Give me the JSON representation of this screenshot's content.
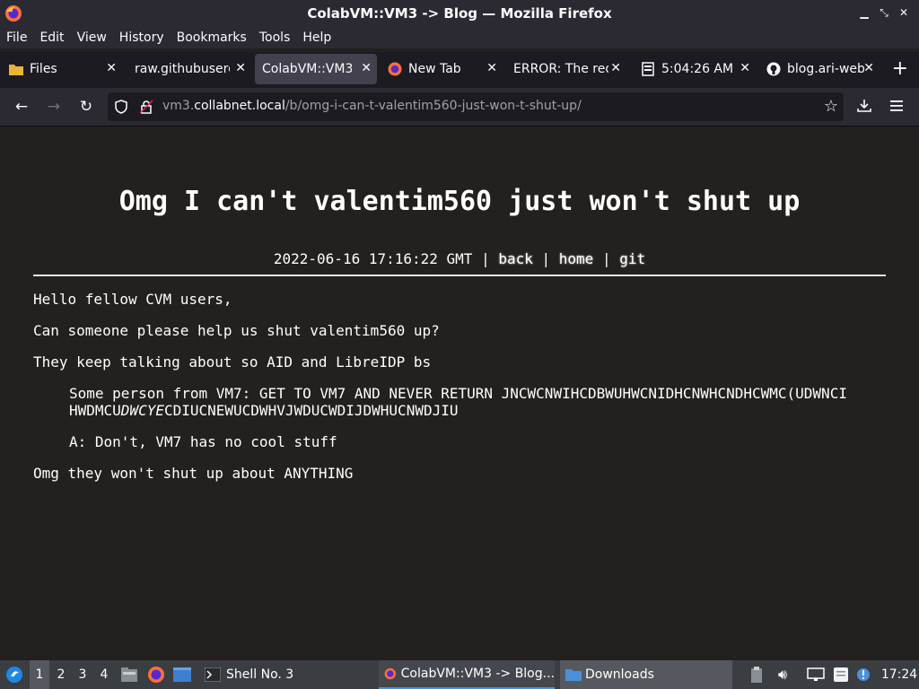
{
  "window": {
    "title": "ColabVM::VM3 -> Blog — Mozilla Firefox"
  },
  "menubar": [
    "File",
    "Edit",
    "View",
    "History",
    "Bookmarks",
    "Tools",
    "Help"
  ],
  "tabs": [
    {
      "label": "Files",
      "icon": "folder-icon",
      "active": false
    },
    {
      "label": "raw.githubuserc",
      "icon": "",
      "active": false
    },
    {
      "label": "ColabVM::VM3",
      "icon": "",
      "active": true
    },
    {
      "label": "New Tab",
      "icon": "firefox-icon",
      "active": false
    },
    {
      "label": "ERROR: The req",
      "icon": "",
      "active": false
    },
    {
      "label": "5:04:26 AM",
      "icon": "clock-icon",
      "active": false
    },
    {
      "label": "blog.ari-web",
      "icon": "github-icon",
      "active": false
    }
  ],
  "navbar": {
    "url_host_prefix": "vm3.",
    "url_host": "collabnet.local",
    "url_path": "/b/omg-i-can-t-valentim560-just-won-t-shut-up/"
  },
  "post": {
    "title": "Omg I can't valentim560 just won't shut up",
    "date": "2022-06-16 17:16:22 GMT",
    "sep1": " | ",
    "back": "back",
    "sep2": " | ",
    "home": "home",
    "sep3": " | ",
    "git": "git",
    "p1": "Hello fellow CVM users,",
    "p2": "Can someone please help us shut valentim560 up?",
    "p3": "They keep talking about so AID and LibreIDP bs",
    "q1_line1": "Some person from VM7: GET TO VM7 AND NEVER RETURN JNCWCNWIHCDBWUHWCNIDHCNWHCNDHCWMC(UDWNCI",
    "q1_line2_a": "HWDMCU",
    "q1_line2_italic": "DWCYE",
    "q1_line2_b": "CDIUCNEWUCDWHVJWDUCWDIJDWHUCNWDJIU",
    "q2": "A: Don't, VM7 has no cool stuff",
    "p4": "Omg they won't shut up about ANYTHING"
  },
  "taskbar": {
    "workspaces": [
      "1",
      "2",
      "3",
      "4"
    ],
    "active_workspace": "1",
    "tasks": [
      {
        "label": "Shell No. 3"
      },
      {
        "label": "ColabVM::VM3 -> Blog..."
      },
      {
        "label": "Downloads"
      }
    ],
    "clock": "17:24"
  }
}
